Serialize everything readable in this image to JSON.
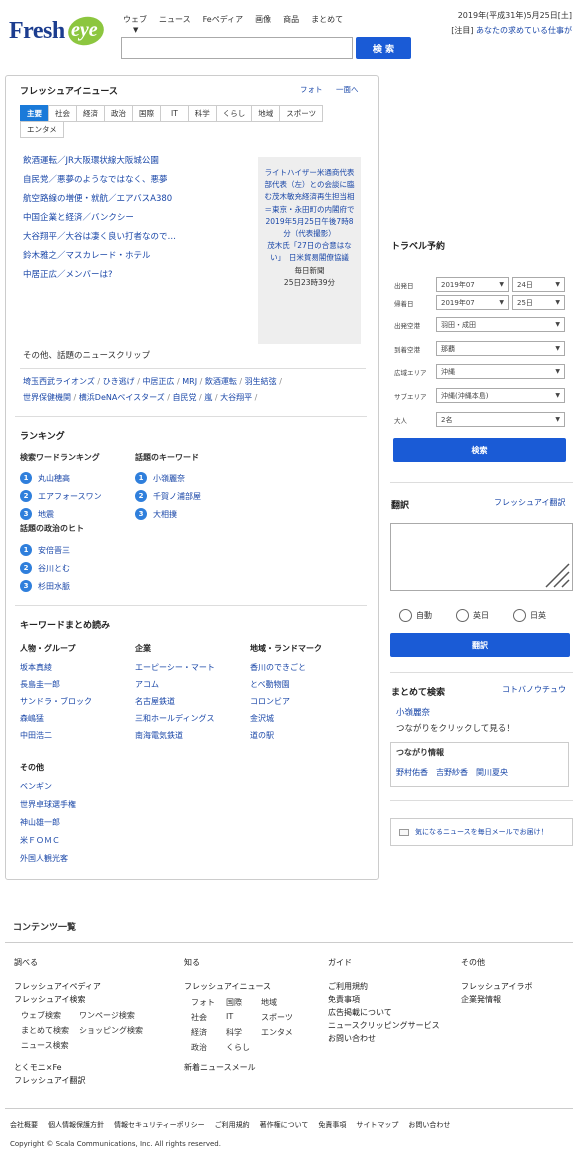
{
  "header": {
    "logo_main": "Fresh",
    "logo_accent": "eye",
    "search_tabs": [
      "ウェブ",
      "ニュース",
      "Feペディア",
      "画像",
      "商品",
      "まとめて"
    ],
    "search_button": "検 索",
    "date": "2019年(平成31年)5月25日[土]",
    "promo_tag": "[注目]",
    "promo_text": "あなたの求めている仕事が"
  },
  "news": {
    "title": "フレッシュアイニュース",
    "photo_link": "フォト",
    "list_link": "一面へ",
    "categories": [
      "主要",
      "社会",
      "経済",
      "政治",
      "国際",
      "IT",
      "科学",
      "くらし",
      "地域",
      "スポーツ",
      "エンタメ"
    ],
    "headlines": [
      "飲酒運転／JR大阪環状線大阪城公園",
      "自民党／悪夢のようなではなく、悪夢",
      "航空路線の増便・就航／エアバスA380",
      "中国企業と経済／バンクシー",
      "大谷翔平／大谷は凄く良い打者なので…",
      "鈴木雅之／マスカレード・ホテル",
      "中居正広／メンバーは?"
    ],
    "photo_caption": "ライトハイザー米通商代表部代表（左）との会談に臨む茂木敏充経済再生担当相＝東京・永田町の内閣府で2019年5月25日午後7時8分（代表撮影）",
    "photo_headline": "茂木氏「27日の合意はない」　日米貿易閣僚協議",
    "photo_source": "毎日新聞",
    "photo_time": "25日23時39分",
    "clip_title": "その他、話題のニュースクリップ",
    "clips": [
      "埼玉西武ライオンズ",
      "ひき逃げ",
      "中居正広",
      "MRJ",
      "飲酒運転",
      "羽生結弦",
      "世界保健機関",
      "横浜DeNAベイスターズ",
      "自民党",
      "嵐",
      "大谷翔平"
    ]
  },
  "ranking": {
    "title": "ランキング",
    "search_title": "検索ワードランキング",
    "search": [
      "丸山穂高",
      "エアフォースワン",
      "地震"
    ],
    "keyword_title": "話題のキーワード",
    "keywords": [
      "小嶺麗奈",
      "千賀ノ浦部屋",
      "大相撲"
    ],
    "politics_title": "話題の政治のヒト",
    "politics": [
      "安倍晋三",
      "谷川とむ",
      "杉田水脈"
    ]
  },
  "matome": {
    "title": "キーワードまとめ読み",
    "cols": [
      {
        "h": "人物・グループ",
        "items": [
          "坂本真綾",
          "長島圭一郎",
          "サンドラ・ブロック",
          "森嶋猛",
          "中田浩二"
        ]
      },
      {
        "h": "企業",
        "items": [
          "エーピーシー・マート",
          "アコム",
          "名古屋鉄道",
          "三和ホールディングス",
          "南海電気鉄道"
        ]
      },
      {
        "h": "地域・ランドマーク",
        "items": [
          "香川のできごと",
          "とべ動物園",
          "コロンビア",
          "金沢城",
          "道の駅"
        ]
      }
    ],
    "other_h": "その他",
    "other": [
      "ベンギン",
      "世界卓球選手権",
      "神山雄一郎",
      "米ＦＯＭＣ",
      "外国人観光客"
    ]
  },
  "travel": {
    "title": "トラベル予約",
    "labels": [
      "出発日",
      "帰着日",
      "出発空港",
      "到着空港",
      "広域エリア",
      "サブエリア",
      "大人"
    ],
    "dep_month": "2019年07",
    "dep_day": "24日",
    "ret_month": "2019年07",
    "ret_day": "25日",
    "dep_airport": "羽田・成田",
    "arr_airport": "那覇",
    "area": "沖縄",
    "sub_area": "沖縄(沖縄本島)",
    "adults": "2名",
    "button": "検索"
  },
  "translate": {
    "title": "翻訳",
    "link": "フレッシュアイ翻訳",
    "options": [
      "自動",
      "英日",
      "日英"
    ],
    "button": "翻訳"
  },
  "matome_search": {
    "title": "まとめて検索",
    "link": "コトバノウチュウ",
    "name": "小嶺麗奈",
    "desc": "つながりをクリックして見る！",
    "conn_title": "つながり情報",
    "conns": [
      "野村佑香",
      "吉野紗香",
      "関川夏央"
    ]
  },
  "mail": {
    "text": "気になるニュースを毎日メールでお届け！"
  },
  "footer": {
    "title": "コンテンツ一覧",
    "col1_h": "調べる",
    "col1": [
      "フレッシュアイペディア",
      "フレッシュアイ検索"
    ],
    "col1_sub": [
      "ウェブ検索",
      "ワンページ検索",
      "まとめて検索",
      "ショッピング検索",
      "ニュース検索"
    ],
    "col1_extra": [
      "とくモニ×Fe",
      "フレッシュアイ翻訳"
    ],
    "col2_h": "知る",
    "col2": [
      "フレッシュアイニュース"
    ],
    "col2_sub": [
      "フォト",
      "国際",
      "地域",
      "社会",
      "IT",
      "スポーツ",
      "経済",
      "科学",
      "エンタメ",
      "政治",
      "くらし"
    ],
    "col2_extra": "新着ニュースメール",
    "col3_h": "ガイド",
    "col3": [
      "ご利用規約",
      "免責事項",
      "広告掲載について",
      "ニュースクリッピングサービス",
      "お問い合わせ"
    ],
    "col4_h": "その他",
    "col4": [
      "フレッシュアイラボ",
      "企業発情報"
    ],
    "bottom": [
      "会社概要",
      "個人情報保護方針",
      "情報セキュリティーポリシー",
      "ご利用規約",
      "著作権について",
      "免責事項",
      "サイトマップ",
      "お問い合わせ"
    ],
    "copyright": "Copyright © Scala Communications, Inc. All rights reserved."
  }
}
